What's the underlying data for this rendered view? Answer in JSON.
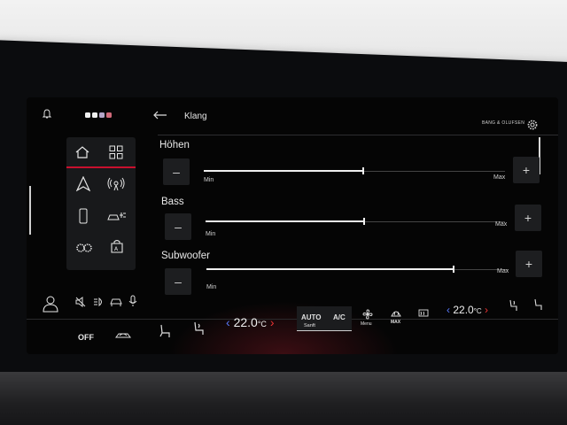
{
  "header": {
    "page_title": "Klang",
    "brand": "BANG & OLUFSEN"
  },
  "sliders": [
    {
      "label": "Höhen",
      "min_label": "Min",
      "max_label": "Max",
      "level": 0.53
    },
    {
      "label": "Bass",
      "min_label": "Min",
      "max_label": "Max",
      "level": 0.53
    },
    {
      "label": "Subwoofer",
      "min_label": "Min",
      "max_label": "Max",
      "level": 0.82
    }
  ],
  "buttons": {
    "decrease": "–",
    "increase": "+"
  },
  "climate": {
    "left_temp": "22.0",
    "left_unit": "°C",
    "right_temp": "22.0",
    "right_unit": "°C",
    "auto_label": "AUTO",
    "auto_sub": "Sanft",
    "ac_label": "A/C",
    "fan_label": "Menu",
    "max_label": "MAX",
    "off_label": "OFF"
  },
  "colors": {
    "accent": "#c8102e",
    "screen_bg": "#050505",
    "cool_arrow": "#5a7bff",
    "warm_arrow": "#e33333"
  },
  "icons": [
    "bell-icon",
    "page-dots-icon",
    "back-icon",
    "gear-icon",
    "home-icon",
    "grid-icon",
    "navigation-icon",
    "radio-icon",
    "phone-icon",
    "car-plug-icon",
    "settings-gears-icon",
    "store-icon",
    "profile-icon",
    "mute-icon",
    "headlight-icon",
    "car-icon",
    "microphone-icon",
    "seat-heat-icon",
    "fan-icon",
    "defrost-front-icon",
    "defrost-rear-icon",
    "steering-heat-icon",
    "recirculation-icon"
  ]
}
